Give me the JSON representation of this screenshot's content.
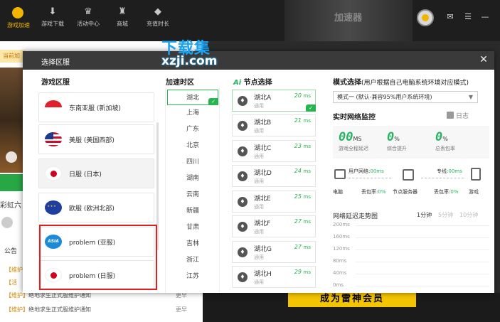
{
  "topbar": {
    "nav": [
      {
        "label": "游戏加速",
        "icon": "logo-icon"
      },
      {
        "label": "游戏下载",
        "icon": "download-icon"
      },
      {
        "label": "活动中心",
        "icon": "crown-icon"
      },
      {
        "label": "商城",
        "icon": "shop-icon"
      },
      {
        "label": "充值时长",
        "icon": "diamond-icon"
      }
    ],
    "banner_text": "加速器"
  },
  "watermark": {
    "line1": "下载集",
    "line2": "xzji.com"
  },
  "background": {
    "yellow_strip": "当前加",
    "game_title": "彩虹六",
    "notice_label": "公告",
    "news": [
      {
        "tag": "【维护】",
        "title": "",
        "more": ""
      },
      {
        "tag": "【活",
        "title": "",
        "more": ""
      },
      {
        "tag": "【维护】",
        "title": "绝地求生正式服维护通知",
        "more": "更早"
      },
      {
        "tag": "【维护】",
        "title": "绝地求生正式服维护通知",
        "more": "更早"
      }
    ],
    "promo": "成为雷神会员"
  },
  "modal": {
    "title": "选择区服",
    "col_regions": "游戏区服",
    "col_cities": "加速时区",
    "col_nodes_prefix": "Ai",
    "col_nodes": "节点选择",
    "regions": [
      {
        "label": "东南亚服 (新加坡)",
        "flag": "sg"
      },
      {
        "label": "美服 (美国西部)",
        "flag": "us"
      },
      {
        "label": "日服 (日本)",
        "flag": "jp"
      },
      {
        "label": "欧服 (欧洲北部)",
        "flag": "eu"
      },
      {
        "label": "problem (亚服)",
        "flag": "asia",
        "flag_text": "ASIA"
      },
      {
        "label": "problem (日服)",
        "flag": "jp"
      }
    ],
    "cities": [
      "湖北",
      "上海",
      "广东",
      "北京",
      "四川",
      "湖南",
      "云南",
      "新疆",
      "甘肃",
      "吉林",
      "浙江",
      "江苏"
    ],
    "selected_city": "湖北",
    "nodes": [
      {
        "name": "湖北A",
        "ping": "20",
        "sub": "通用"
      },
      {
        "name": "湖北B",
        "ping": "21",
        "sub": "通用"
      },
      {
        "name": "湖北C",
        "ping": "23",
        "sub": "通用"
      },
      {
        "name": "湖北D",
        "ping": "24",
        "sub": "通用"
      },
      {
        "name": "湖北E",
        "ping": "25",
        "sub": "通用"
      },
      {
        "name": "湖北F",
        "ping": "27",
        "sub": "通用"
      },
      {
        "name": "湖北G",
        "ping": "27",
        "sub": "通用"
      },
      {
        "name": "湖北H",
        "ping": "29",
        "sub": "通用"
      }
    ],
    "ping_unit": "ms",
    "mode": {
      "title": "模式选择",
      "hint": "(用户根据自己电脑系统环境对应模式)",
      "selected": "模式一 (默认-兼容95%用户系统环境)"
    },
    "monitor": {
      "title": "实时网络监控",
      "log_label": "日志",
      "stats": [
        {
          "value": "00",
          "unit": "MS",
          "caption": "游戏全程延迟"
        },
        {
          "value": "0",
          "unit": "%",
          "caption": "综合提升"
        },
        {
          "value": "0",
          "unit": "%",
          "caption": "总丢包率"
        }
      ],
      "user_net": "用户网络:",
      "user_net_val": "00ms",
      "line": "专线:",
      "line_val": "00ms",
      "pc": "电脑",
      "loss1": "丢包率:",
      "loss1_val": "0%",
      "node_server": "节点服务器",
      "loss2": "丢包率:",
      "loss2_val": "0%",
      "game": "游戏"
    },
    "trend": {
      "title": "网络延迟走势图",
      "tabs": [
        "1分钟",
        "5分钟",
        "10分钟"
      ],
      "y_labels": [
        "200ms",
        "160ms",
        "120ms",
        "80ms",
        "40ms",
        "0ms"
      ]
    }
  }
}
